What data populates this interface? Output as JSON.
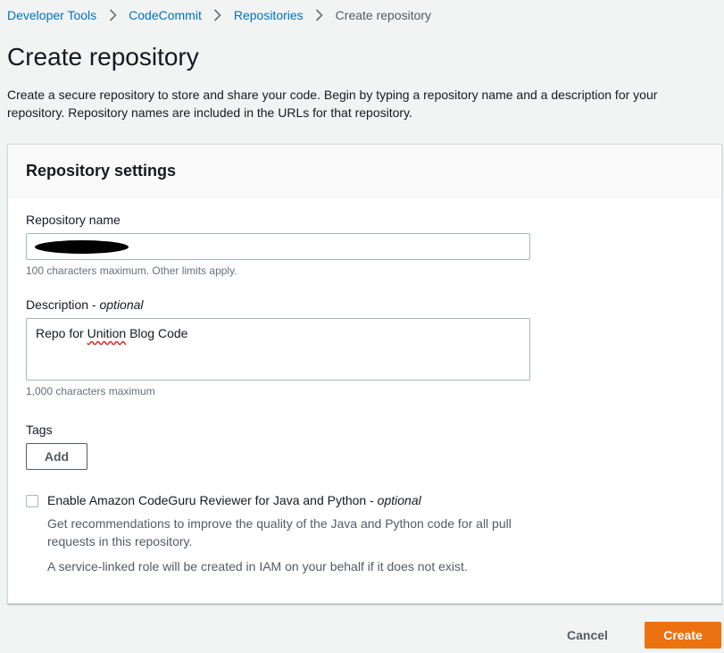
{
  "breadcrumb": {
    "items": [
      "Developer Tools",
      "CodeCommit",
      "Repositories"
    ],
    "current": "Create repository"
  },
  "page": {
    "title": "Create repository",
    "description": "Create a secure repository to store and share your code. Begin by typing a repository name and a description for your repository. Repository names are included in the URLs for that repository."
  },
  "settings": {
    "title": "Repository settings",
    "name": {
      "label": "Repository name",
      "value": "",
      "hint": "100 characters maximum. Other limits apply."
    },
    "description": {
      "label": "Description",
      "optional": "optional",
      "value_prefix": "Repo for ",
      "value_flagged": "Unition",
      "value_suffix": " Blog Code",
      "hint": "1,000 characters maximum"
    },
    "tags": {
      "label": "Tags",
      "add_label": "Add"
    },
    "codeguru": {
      "label": "Enable Amazon CodeGuru Reviewer for Java and Python",
      "optional": "optional",
      "checked": false,
      "description": "Get recommendations to improve the quality of the Java and Python code for all pull requests in this repository.",
      "note": "A service-linked role will be created in IAM on your behalf if it does not exist."
    }
  },
  "actions": {
    "cancel_label": "Cancel",
    "create_label": "Create"
  },
  "colors": {
    "link": "#0073bb",
    "primary": "#ec7211",
    "background": "#f2f3f3"
  }
}
